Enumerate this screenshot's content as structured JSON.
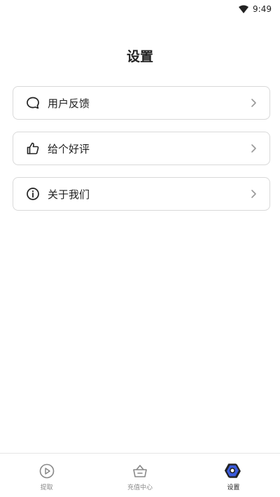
{
  "status_bar": {
    "time": "9:49",
    "wifi_icon": "wifi-icon"
  },
  "page": {
    "title": "设置"
  },
  "menu": {
    "items": [
      {
        "label": "用户反馈",
        "icon": "chat-bubble-icon"
      },
      {
        "label": "给个好评",
        "icon": "thumbs-up-icon"
      },
      {
        "label": "关于我们",
        "icon": "info-icon"
      }
    ]
  },
  "tabs": [
    {
      "label": "提取",
      "icon": "play-circle-icon",
      "active": false
    },
    {
      "label": "充值中心",
      "icon": "basket-icon",
      "active": false
    },
    {
      "label": "设置",
      "icon": "settings-nut-icon",
      "active": true
    }
  ],
  "colors": {
    "accent": "#3b5bdb",
    "text": "#222222",
    "muted": "#888888",
    "border": "#d9d9d9"
  }
}
